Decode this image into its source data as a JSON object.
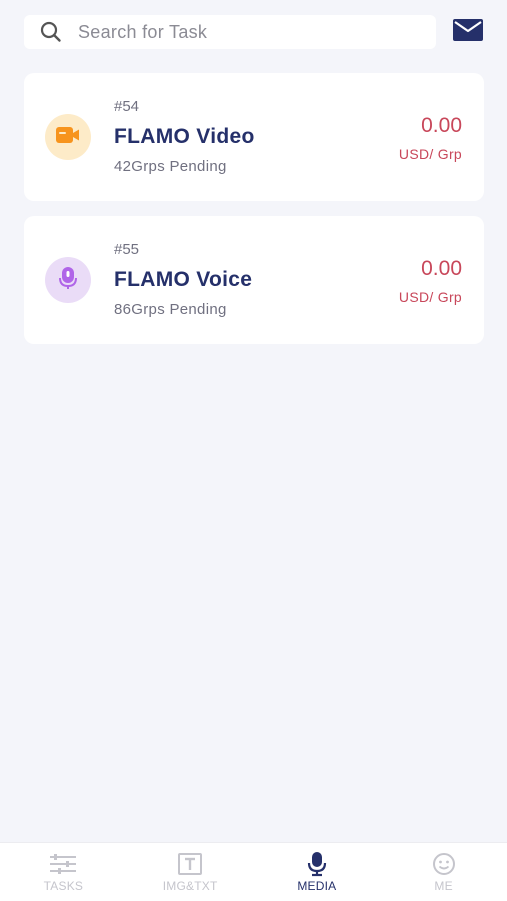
{
  "search": {
    "placeholder": "Search for Task"
  },
  "header": {
    "mail_icon": "mail-icon"
  },
  "tasks": [
    {
      "number": "#54",
      "name": "FLAMO Video",
      "pending": "42Grps Pending",
      "price": "0.00",
      "unit": "USD/ Grp",
      "icon": "video-icon"
    },
    {
      "number": "#55",
      "name": "FLAMO Voice",
      "pending": "86Grps Pending",
      "price": "0.00",
      "unit": "USD/ Grp",
      "icon": "microphone-icon"
    }
  ],
  "tabbar": {
    "items": [
      {
        "label": "TASKS",
        "icon": "sliders-icon",
        "active": false
      },
      {
        "label": "IMG&TXT",
        "icon": "text-box-icon",
        "active": false
      },
      {
        "label": "MEDIA",
        "icon": "microphone-icon",
        "active": true
      },
      {
        "label": "ME",
        "icon": "smiley-icon",
        "active": false
      }
    ]
  },
  "colors": {
    "background": "#f4f5fa",
    "title": "#25306a",
    "price": "#c8475a",
    "video_badge": "#fdebc8",
    "video_icon": "#f7941d",
    "voice_badge": "#eadcf7",
    "voice_icon": "#b065e8",
    "tab_inactive": "#c5c5cc",
    "tab_active": "#25306a"
  }
}
